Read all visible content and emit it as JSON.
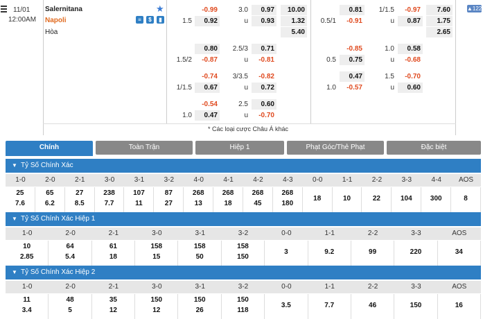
{
  "match": {
    "date": "11/01",
    "time": "12:00AM",
    "home": "Salernitana",
    "away": "Napoli",
    "draw": "Hòa",
    "badge_count": "122",
    "icons": [
      "stats-icon",
      "money-icon",
      "chart-icon"
    ]
  },
  "odds": {
    "ft": [
      {
        "h_line": "",
        "h_home": "-0.99",
        "h_away": "0.92",
        "ou_line": "3.0",
        "ou_over": "0.97",
        "ou_under": "0.93",
        "x1": "10.00",
        "x2": "1.32",
        "xd": "5.40",
        "a_line": "1.5",
        "u_lbl": "u"
      },
      {
        "h_home": "0.80",
        "h_away": "-0.87",
        "a_line": "1.5/2",
        "ou_line": "2.5/3",
        "ou_over": "0.71",
        "ou_under": "-0.81",
        "u_lbl": "u"
      },
      {
        "h_home": "-0.74",
        "h_away": "0.67",
        "a_line": "1/1.5",
        "ou_line": "3/3.5",
        "ou_over": "-0.82",
        "ou_under": "0.72",
        "u_lbl": "u"
      },
      {
        "h_home": "-0.54",
        "h_away": "0.47",
        "a_line": "1.0",
        "ou_line": "2.5",
        "ou_over": "0.60",
        "ou_under": "-0.70",
        "u_lbl": "u"
      }
    ],
    "ht": [
      {
        "h_home": "0.81",
        "h_away": "-0.91",
        "a_line": "0.5/1",
        "ou_line": "1/1.5",
        "ou_over": "-0.97",
        "ou_under": "0.87",
        "x1": "7.60",
        "x2": "1.75",
        "xd": "2.65",
        "u_lbl": "u"
      },
      {
        "h_home": "-0.85",
        "h_away": "0.75",
        "a_line": "0.5",
        "ou_line": "1.0",
        "ou_over": "0.58",
        "ou_under": "-0.68",
        "u_lbl": "u"
      },
      {
        "h_home": "0.47",
        "h_away": "-0.57",
        "a_line": "1.0",
        "ou_line": "1.5",
        "ou_over": "-0.70",
        "ou_under": "0.60",
        "u_lbl": "u"
      }
    ],
    "note": "* Các loại cược Châu Á khác"
  },
  "tabs": [
    "Chính",
    "Toàn Trận",
    "Hiệp 1",
    "Phạt Góc/Thẻ Phạt",
    "Đặc biệt"
  ],
  "sections": [
    {
      "title": "Tỷ Số Chính Xác",
      "headers": [
        "1-0",
        "2-0",
        "2-1",
        "3-0",
        "3-1",
        "3-2",
        "4-0",
        "4-1",
        "4-2",
        "4-3",
        "0-0",
        "1-1",
        "2-2",
        "3-3",
        "4-4",
        "AOS"
      ],
      "top": [
        "25",
        "65",
        "27",
        "238",
        "107",
        "87",
        "268",
        "268",
        "268",
        "268",
        "18",
        "10",
        "22",
        "104",
        "300",
        "8"
      ],
      "bottom": [
        "7.6",
        "6.2",
        "8.5",
        "7.7",
        "11",
        "27",
        "13",
        "18",
        "45",
        "180",
        "",
        "",
        "",
        "",
        "",
        ""
      ]
    },
    {
      "title": "Tỷ Số Chính Xác Hiệp 1",
      "headers": [
        "1-0",
        "2-0",
        "2-1",
        "3-0",
        "3-1",
        "3-2",
        "0-0",
        "1-1",
        "2-2",
        "3-3",
        "AOS"
      ],
      "top": [
        "10",
        "64",
        "61",
        "158",
        "158",
        "158",
        "3",
        "9.2",
        "99",
        "220",
        "34"
      ],
      "bottom": [
        "2.85",
        "5.4",
        "18",
        "15",
        "50",
        "150",
        "",
        "",
        "",
        "",
        ""
      ]
    },
    {
      "title": "Tỷ Số Chính Xác Hiệp 2",
      "headers": [
        "1-0",
        "2-0",
        "2-1",
        "3-0",
        "3-1",
        "3-2",
        "0-0",
        "1-1",
        "2-2",
        "3-3",
        "AOS"
      ],
      "top": [
        "11",
        "48",
        "35",
        "150",
        "150",
        "150",
        "3.5",
        "7.7",
        "46",
        "150",
        "16"
      ],
      "bottom": [
        "3.4",
        "5",
        "12",
        "12",
        "26",
        "118",
        "",
        "",
        "",
        "",
        ""
      ]
    }
  ]
}
